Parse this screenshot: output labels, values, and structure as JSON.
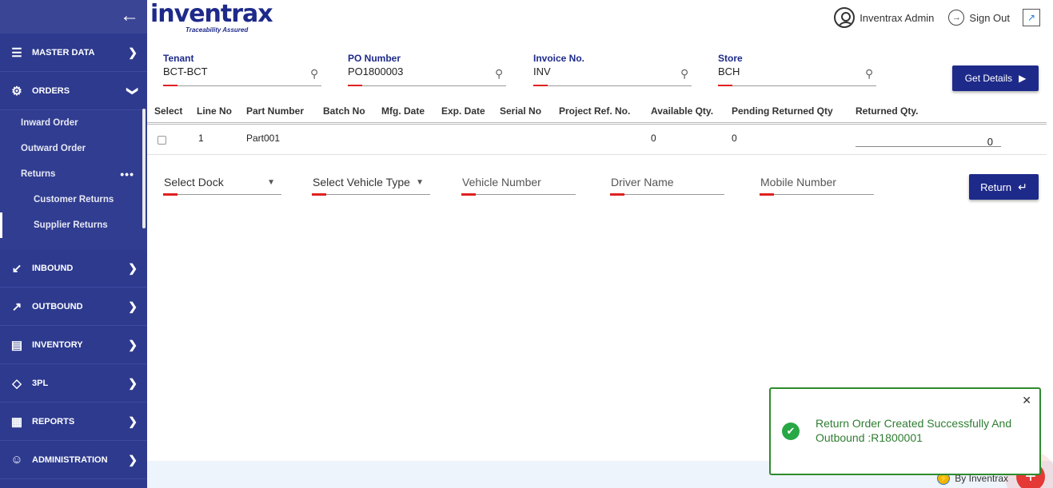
{
  "header": {
    "logo_text": "inventrax",
    "logo_tagline": "Traceability Assured",
    "user_name": "Inventrax Admin",
    "sign_out_label": "Sign Out"
  },
  "sidebar": {
    "items": [
      {
        "label": "MASTER DATA",
        "icon": "grid-list-icon"
      },
      {
        "label": "ORDERS",
        "icon": "gears-icon"
      },
      {
        "label": "INBOUND",
        "icon": "inbound-icon"
      },
      {
        "label": "OUTBOUND",
        "icon": "outbound-icon"
      },
      {
        "label": "INVENTORY",
        "icon": "inventory-icon"
      },
      {
        "label": "3PL",
        "icon": "diamond-icon"
      },
      {
        "label": "REPORTS",
        "icon": "chart-icon"
      },
      {
        "label": "ADMINISTRATION",
        "icon": "users-icon"
      }
    ],
    "orders_sub": {
      "inward": "Inward Order",
      "outward": "Outward Order",
      "returns": "Returns",
      "customer_returns": "Customer Returns",
      "supplier_returns": "Supplier Returns"
    }
  },
  "filters": {
    "tenant": {
      "label": "Tenant",
      "value": "BCT-BCT"
    },
    "po": {
      "label": "PO Number",
      "value": "PO1800003"
    },
    "invoice": {
      "label": "Invoice No.",
      "value": "INV"
    },
    "store": {
      "label": "Store",
      "value": "BCH"
    },
    "get_details": "Get Details"
  },
  "table": {
    "columns": [
      "Select",
      "Line No",
      "Part Number",
      "Batch No",
      "Mfg. Date",
      "Exp. Date",
      "Serial No",
      "Project Ref. No.",
      "Available Qty.",
      "Pending Returned Qty",
      "Returned Qty."
    ],
    "rows": [
      {
        "line_no": "1",
        "part_number": "Part001",
        "available_qty": "0",
        "pending_returned_qty": "0",
        "returned_qty": "0"
      }
    ]
  },
  "return_form": {
    "dock_placeholder": "Select Dock",
    "vehicle_type_placeholder": "Select Vehicle Type",
    "vehicle_number_placeholder": "Vehicle Number",
    "driver_name_placeholder": "Driver Name",
    "mobile_number_placeholder": "Mobile Number",
    "return_button": "Return"
  },
  "toast": {
    "message": "Return Order Created Successfully And Outbound :R1800001"
  },
  "footer": {
    "by_text": "By Inventrax"
  },
  "colors": {
    "sidebar_bg": "#2d3a8e",
    "primary": "#1e2a8a",
    "accent_red": "#e02020",
    "success": "#2e8b2e"
  }
}
